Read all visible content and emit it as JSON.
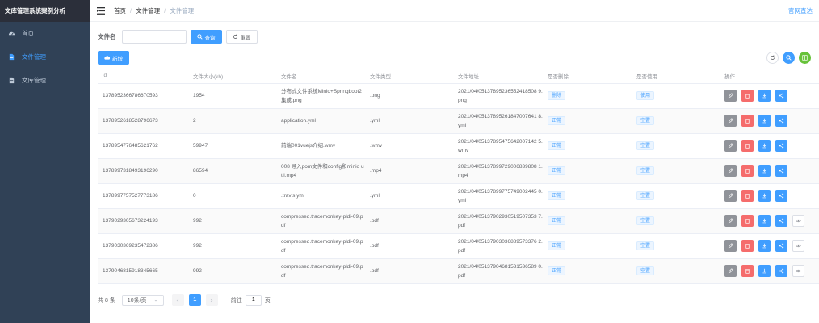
{
  "app_title": "文库管理系统案例分析",
  "sidebar": {
    "items": [
      {
        "label": "首页",
        "icon": "dashboard-icon"
      },
      {
        "label": "文件管理",
        "icon": "file-icon"
      },
      {
        "label": "文库管理",
        "icon": "document-icon"
      }
    ]
  },
  "navbar": {
    "breadcrumbs": [
      "首页",
      "文件管理",
      "文件管理"
    ],
    "official_link": "官网直达"
  },
  "search": {
    "label": "文件名",
    "placeholder": "",
    "search_button": "查询",
    "reset_button": "重置"
  },
  "toolbar": {
    "add_button": "新增"
  },
  "table": {
    "columns": [
      "id",
      "文件大小(kb)",
      "文件名",
      "文件类型",
      "文件地址",
      "是否删除",
      "是否使用",
      "操作"
    ],
    "rows": [
      {
        "id": "1378952366786670593",
        "size": "1954",
        "name": "分布式文件系统Minio+Springboot2集成.png",
        "type": ".png",
        "url": "2021/04/05137895236552418508 9.png",
        "deleted": "删除",
        "used": "使用",
        "preview": false
      },
      {
        "id": "1378952618528796673",
        "size": "2",
        "name": "application.yml",
        "type": ".yml",
        "url": "2021/04/05137895261847007641 8.yml",
        "deleted": "正常",
        "used": "空置",
        "preview": false
      },
      {
        "id": "1378954776485621762",
        "size": "59947",
        "name": "前端001vuejs介绍.wmv",
        "type": ".wmv",
        "url": "2021/04/05137895475642007142 5.wmv",
        "deleted": "正常",
        "used": "空置",
        "preview": false
      },
      {
        "id": "1378997318493196290",
        "size": "86594",
        "name": "008 导入pom文件和config和minio util.mp4",
        "type": ".mp4",
        "url": "2021/04/05137899729006839808 1.mp4",
        "deleted": "正常",
        "used": "空置",
        "preview": false
      },
      {
        "id": "1378997757527773186",
        "size": "0",
        "name": ".travis.yml",
        "type": ".yml",
        "url": "2021/04/05137899775749002445 0.yml",
        "deleted": "正常",
        "used": "空置",
        "preview": false
      },
      {
        "id": "1379029305673224193",
        "size": "992",
        "name": "compressed.tracemonkey-pldi-09.pdf",
        "type": ".pdf",
        "url": "2021/04/05137902930519507353 7.pdf",
        "deleted": "正常",
        "used": "空置",
        "preview": true
      },
      {
        "id": "1379030369235472386",
        "size": "992",
        "name": "compressed.tracemonkey-pldi-09.pdf",
        "type": ".pdf",
        "url": "2021/04/05137903036889573376 2.pdf",
        "deleted": "正常",
        "used": "空置",
        "preview": true
      },
      {
        "id": "1379046815918345665",
        "size": "992",
        "name": "compressed.tracemonkey-pldi-09.pdf",
        "type": ".pdf",
        "url": "2021/04/05137904681531536589 0.pdf",
        "deleted": "正常",
        "used": "空置",
        "preview": true
      }
    ]
  },
  "pagination": {
    "total_text": "共 8 条",
    "page_size": "10条/页",
    "current_page": "1",
    "goto_label": "前往",
    "goto_value": "1",
    "page_unit": "页"
  },
  "colors": {
    "primary": "#409eff",
    "danger": "#f56c6c",
    "info": "#909399",
    "success": "#67c23a",
    "sidebar": "#304156"
  }
}
